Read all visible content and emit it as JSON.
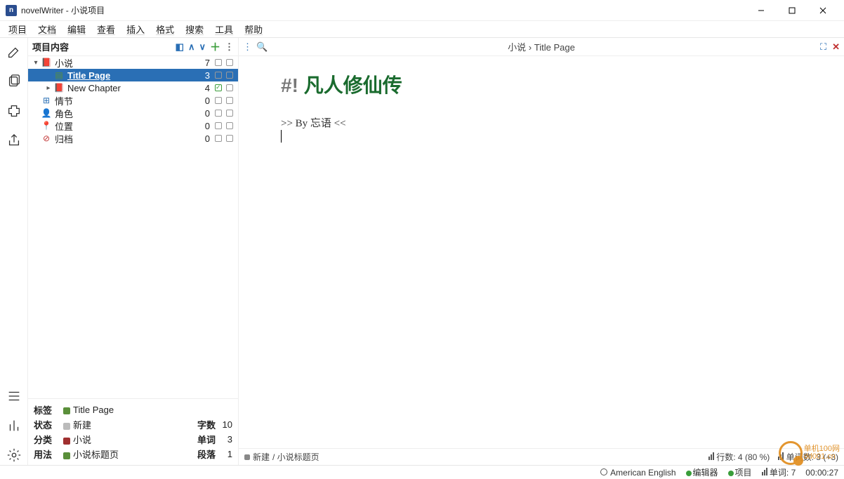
{
  "window": {
    "title": "novelWriter - 小说项目"
  },
  "menu": [
    "项目",
    "文档",
    "编辑",
    "查看",
    "插入",
    "格式",
    "搜索",
    "工具",
    "帮助"
  ],
  "project_panel": {
    "header": "项目内容",
    "tree": [
      {
        "indent": 0,
        "twisty": "▾",
        "icon": "book",
        "label": "小说",
        "count": "7",
        "status": "sq",
        "selected": false
      },
      {
        "indent": 1,
        "twisty": "",
        "icon": "page",
        "label": "Title Page",
        "count": "3",
        "status": "sq",
        "selected": true
      },
      {
        "indent": 1,
        "twisty": "▸",
        "icon": "book",
        "label": "New Chapter",
        "count": "4",
        "status": "chk",
        "selected": false
      },
      {
        "indent": 0,
        "twisty": "",
        "icon": "plot",
        "label": "情节",
        "count": "0",
        "status": "sq",
        "selected": false
      },
      {
        "indent": 0,
        "twisty": "",
        "icon": "char",
        "label": "角色",
        "count": "0",
        "status": "sq",
        "selected": false
      },
      {
        "indent": 0,
        "twisty": "",
        "icon": "loc",
        "label": "位置",
        "count": "0",
        "status": "sq",
        "selected": false
      },
      {
        "indent": 0,
        "twisty": "",
        "icon": "arc",
        "label": "归档",
        "count": "0",
        "status": "sq",
        "selected": false
      }
    ],
    "info": {
      "tag_k": "标签",
      "tag_v": "Title Page",
      "status_k": "状态",
      "status_v": "新建",
      "class_k": "分类",
      "class_v": "小说",
      "usage_k": "用法",
      "usage_v": "小说标题页",
      "wc_k": "字数",
      "wc_v": "10",
      "word_k": "单词",
      "word_v": "3",
      "para_k": "段落",
      "para_v": "1"
    }
  },
  "editor": {
    "breadcrumb_root": "小说",
    "breadcrumb_sep": " › ",
    "breadcrumb_leaf": "Title Page",
    "title_prefix": "#! ",
    "title_text": "凡人修仙传",
    "byline": ">> By 忘语 <<",
    "footer_status": "新建",
    "footer_path": "/ 小说标题页",
    "line_info": "行数: 4 (80 %)",
    "word_info": "单词数: 3 (+3)"
  },
  "statusbar": {
    "lang": "American English",
    "editor_label": "编辑器",
    "project_label": "项目",
    "words_label": "单词:",
    "words_val": "7",
    "time": "00:00:27"
  },
  "watermark": {
    "site": "单机100网",
    "url": "dd001.cn"
  }
}
